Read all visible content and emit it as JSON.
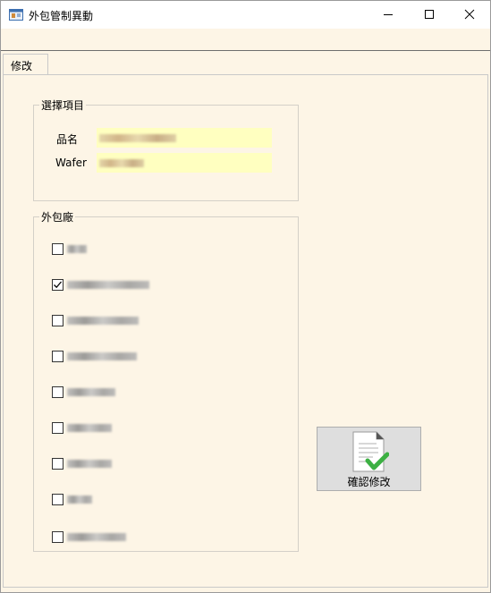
{
  "window": {
    "title": "外包管制異動"
  },
  "tabs": [
    {
      "label": "修改",
      "selected": true
    }
  ],
  "selection_group": {
    "title": "選擇項目",
    "fields": [
      {
        "label": "品名"
      },
      {
        "label": "Wafer"
      }
    ]
  },
  "vendor_group": {
    "title": "外包廠",
    "items": [
      {
        "checked": false
      },
      {
        "checked": true
      },
      {
        "checked": false
      },
      {
        "checked": false
      },
      {
        "checked": false
      },
      {
        "checked": false
      },
      {
        "checked": false
      },
      {
        "checked": false
      },
      {
        "checked": false
      }
    ]
  },
  "confirm_button": {
    "label": "確認修改",
    "icon": "document-check-icon"
  },
  "colors": {
    "form_bg": "#fdf5e6",
    "field_bg": "#ffffc0",
    "check_green": "#3cb043"
  }
}
